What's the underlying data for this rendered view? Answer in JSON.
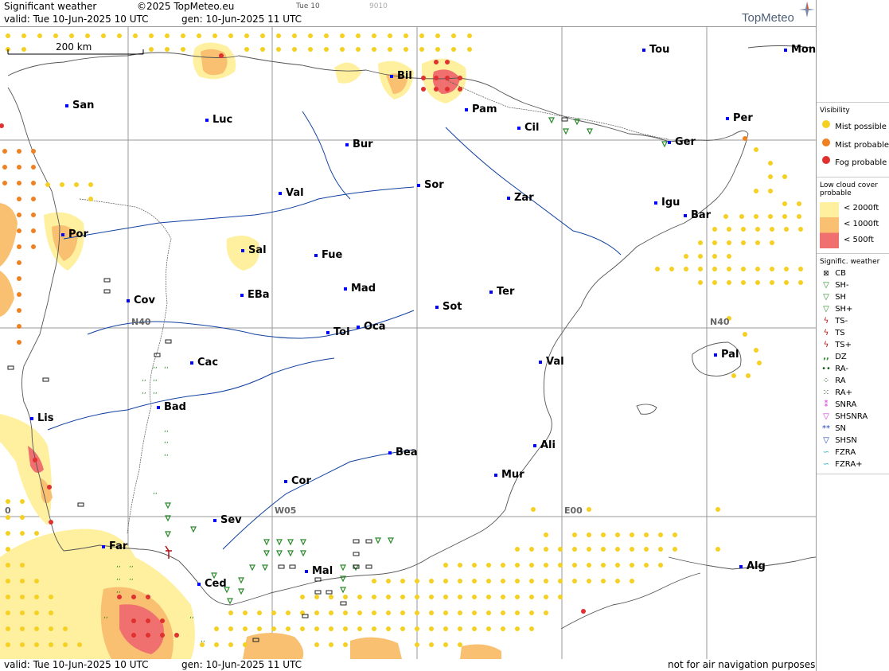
{
  "header": {
    "title": "Significant weather",
    "copyright": "©2025 TopMeteo.eu",
    "day_code": "Tue 10",
    "code_small": "9010",
    "valid": "valid:  Tue  10-Jun-2025  10 UTC",
    "generated": "gen: 10-Jun-2025 11 UTC",
    "logo_text": "TopMeteo"
  },
  "footer": {
    "valid": "valid:  Tue  10-Jun-2025  10 UTC",
    "generated": "gen: 10-Jun-2025 11 UTC",
    "disclaimer": "not for air navigation purposes"
  },
  "map": {
    "scale_label": "200 km",
    "grid_labels": {
      "n40_west": "N40",
      "n40_east": "N40",
      "w05": "W05",
      "e00": "E00",
      "w10": "0"
    },
    "cities": [
      {
        "name": "Tou",
        "id": "tou"
      },
      {
        "name": "Mon",
        "id": "mon"
      },
      {
        "name": "San",
        "id": "san"
      },
      {
        "name": "Luc",
        "id": "luc"
      },
      {
        "name": "Bil",
        "id": "bil"
      },
      {
        "name": "Pam",
        "id": "pam"
      },
      {
        "name": "Cil",
        "id": "cil"
      },
      {
        "name": "Per",
        "id": "per"
      },
      {
        "name": "Bur",
        "id": "bur"
      },
      {
        "name": "Ger",
        "id": "ger"
      },
      {
        "name": "Sor",
        "id": "sor"
      },
      {
        "name": "Val",
        "id": "valladolid"
      },
      {
        "name": "Zar",
        "id": "zar"
      },
      {
        "name": "Igu",
        "id": "igu"
      },
      {
        "name": "Bar",
        "id": "bar"
      },
      {
        "name": "Por",
        "id": "por"
      },
      {
        "name": "Sal",
        "id": "sal"
      },
      {
        "name": "Fue",
        "id": "fue"
      },
      {
        "name": "Mad",
        "id": "mad"
      },
      {
        "name": "Ter",
        "id": "ter"
      },
      {
        "name": "Cov",
        "id": "cov"
      },
      {
        "name": "EBa",
        "id": "eba"
      },
      {
        "name": "Sot",
        "id": "sot"
      },
      {
        "name": "Tol",
        "id": "tol"
      },
      {
        "name": "Oca",
        "id": "oca"
      },
      {
        "name": "Pal",
        "id": "pal"
      },
      {
        "name": "Cac",
        "id": "cac"
      },
      {
        "name": "Val",
        "id": "valencia"
      },
      {
        "name": "Bad",
        "id": "bad"
      },
      {
        "name": "Lis",
        "id": "lis"
      },
      {
        "name": "Bea",
        "id": "bea"
      },
      {
        "name": "Ali",
        "id": "ali"
      },
      {
        "name": "Mur",
        "id": "mur"
      },
      {
        "name": "Cor",
        "id": "cor"
      },
      {
        "name": "Sev",
        "id": "sev"
      },
      {
        "name": "Far",
        "id": "far"
      },
      {
        "name": "Alg",
        "id": "alg"
      },
      {
        "name": "Mal",
        "id": "mal"
      },
      {
        "name": "Ced",
        "id": "ced"
      }
    ]
  },
  "legend": {
    "visibility": {
      "title": "Visibility",
      "items": [
        {
          "label": "Mist possible",
          "icon": "mist-possible-icon",
          "color": "#f5d020"
        },
        {
          "label": "Mist probable",
          "icon": "mist-probable-icon",
          "color": "#f08020"
        },
        {
          "label": "Fog probable",
          "icon": "fog-probable-icon",
          "color": "#e03030"
        }
      ]
    },
    "low_cloud": {
      "title_line1": "Low cloud cover",
      "title_line2": "probable",
      "items": [
        {
          "label": "< 2000ft",
          "color": "#fff0a0"
        },
        {
          "label": "< 1000ft",
          "color": "#f8c070"
        },
        {
          "label": "<   500ft",
          "color": "#f07070"
        }
      ]
    },
    "weather": {
      "title": "Signific. weather",
      "items": [
        {
          "label": "CB",
          "icon": "cb-icon"
        },
        {
          "label": "SH-",
          "icon": "shower-light-icon"
        },
        {
          "label": "SH",
          "icon": "shower-icon"
        },
        {
          "label": "SH+",
          "icon": "shower-heavy-icon"
        },
        {
          "label": "TS-",
          "icon": "thunderstorm-light-icon"
        },
        {
          "label": "TS",
          "icon": "thunderstorm-icon"
        },
        {
          "label": "TS+",
          "icon": "thunderstorm-heavy-icon"
        },
        {
          "label": "DZ",
          "icon": "drizzle-icon"
        },
        {
          "label": "RA-",
          "icon": "rain-light-icon"
        },
        {
          "label": "RA",
          "icon": "rain-icon"
        },
        {
          "label": "RA+",
          "icon": "rain-heavy-icon"
        },
        {
          "label": "SNRA",
          "icon": "snow-rain-icon"
        },
        {
          "label": "SHSNRA",
          "icon": "snow-rain-shower-icon"
        },
        {
          "label": "SN",
          "icon": "snow-icon"
        },
        {
          "label": "SHSN",
          "icon": "snow-shower-icon"
        },
        {
          "label": "FZRA",
          "icon": "freezing-rain-icon"
        },
        {
          "label": "FZRA+",
          "icon": "freezing-rain-heavy-icon"
        }
      ]
    }
  }
}
